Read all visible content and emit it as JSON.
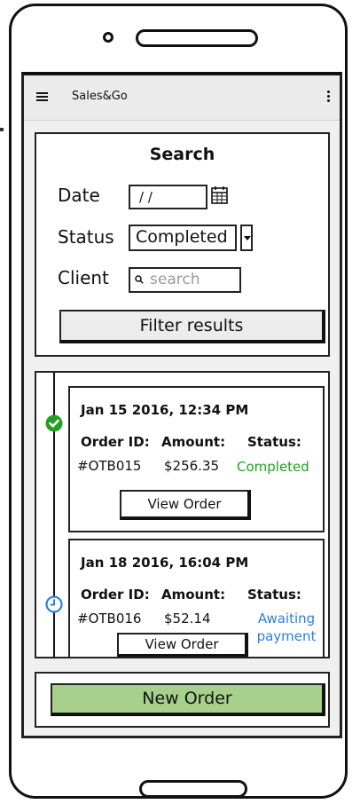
{
  "app": {
    "title": "Sales&Go",
    "menu_icon": "hamburger-icon",
    "overflow_icon": "kebab-menu-icon"
  },
  "search": {
    "title": "Search",
    "date_label": "Date",
    "date_value": "/ /",
    "calendar_icon": "calendar-icon",
    "status_label": "Status",
    "status_value": "Completed",
    "client_label": "Client",
    "client_placeholder": "search",
    "filter_button": "Filter results"
  },
  "orders": [
    {
      "datetime": "Jan 15 2016, 12:34 PM",
      "order_id_label": "Order ID:",
      "amount_label": "Amount:",
      "status_label": "Status:",
      "order_id": "#OTB015",
      "amount": "$256.35",
      "status": "Completed",
      "status_icon": "check-circle-icon",
      "status_color": "#22a022",
      "button": "View Order"
    },
    {
      "datetime": "Jan 18 2016, 16:04 PM",
      "order_id_label": "Order ID:",
      "amount_label": "Amount:",
      "status_label": "Status:",
      "order_id": "#OTB016",
      "amount": "$52.14",
      "status_line1": "Awaiting",
      "status_line2": "payment",
      "status_icon": "clock-icon",
      "status_color": "#2f7de1",
      "button": "View Order"
    }
  ],
  "bottom": {
    "new_order_button": "New Order",
    "button_color": "#a8d08d"
  }
}
